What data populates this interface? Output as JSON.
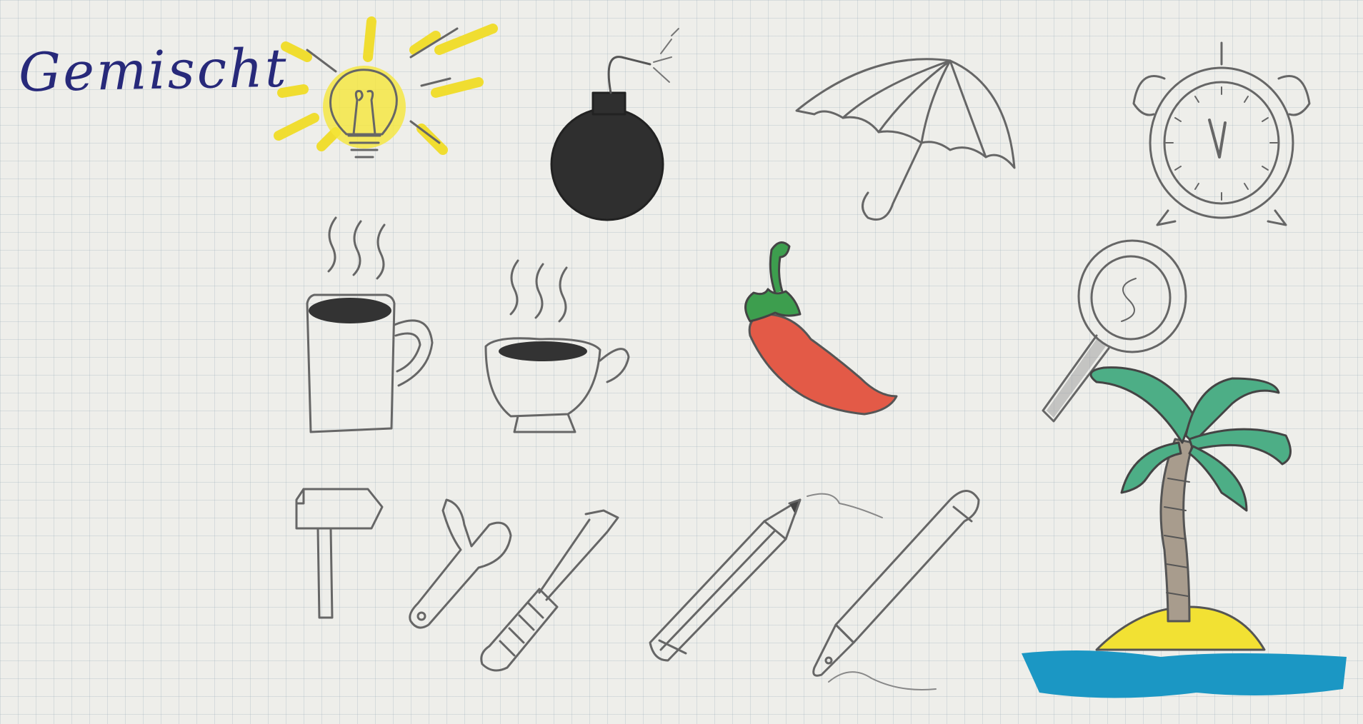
{
  "page": {
    "title": "Gemischt"
  },
  "doodles": [
    {
      "name": "light-bulb-icon"
    },
    {
      "name": "bomb-icon"
    },
    {
      "name": "umbrella-icon"
    },
    {
      "name": "alarm-clock-icon"
    },
    {
      "name": "steaming-mug-icon"
    },
    {
      "name": "steaming-cup-icon"
    },
    {
      "name": "chili-pepper-icon"
    },
    {
      "name": "magnifying-glass-icon"
    },
    {
      "name": "palm-island-icon"
    },
    {
      "name": "hammer-icon"
    },
    {
      "name": "wrench-icon"
    },
    {
      "name": "screwdriver-icon"
    },
    {
      "name": "pencil-icon"
    },
    {
      "name": "fountain-pen-icon"
    }
  ],
  "colors": {
    "paper": "#eeeeea",
    "grid": "#aab9c4",
    "ink": "#555555",
    "title_ink": "#27297a",
    "sun_yellow": "#f2e33a",
    "chili_red": "#e0574a",
    "leaf_green": "#4cae86",
    "sea_blue": "#1f93bf",
    "trunk_brown": "#9b8f82"
  }
}
